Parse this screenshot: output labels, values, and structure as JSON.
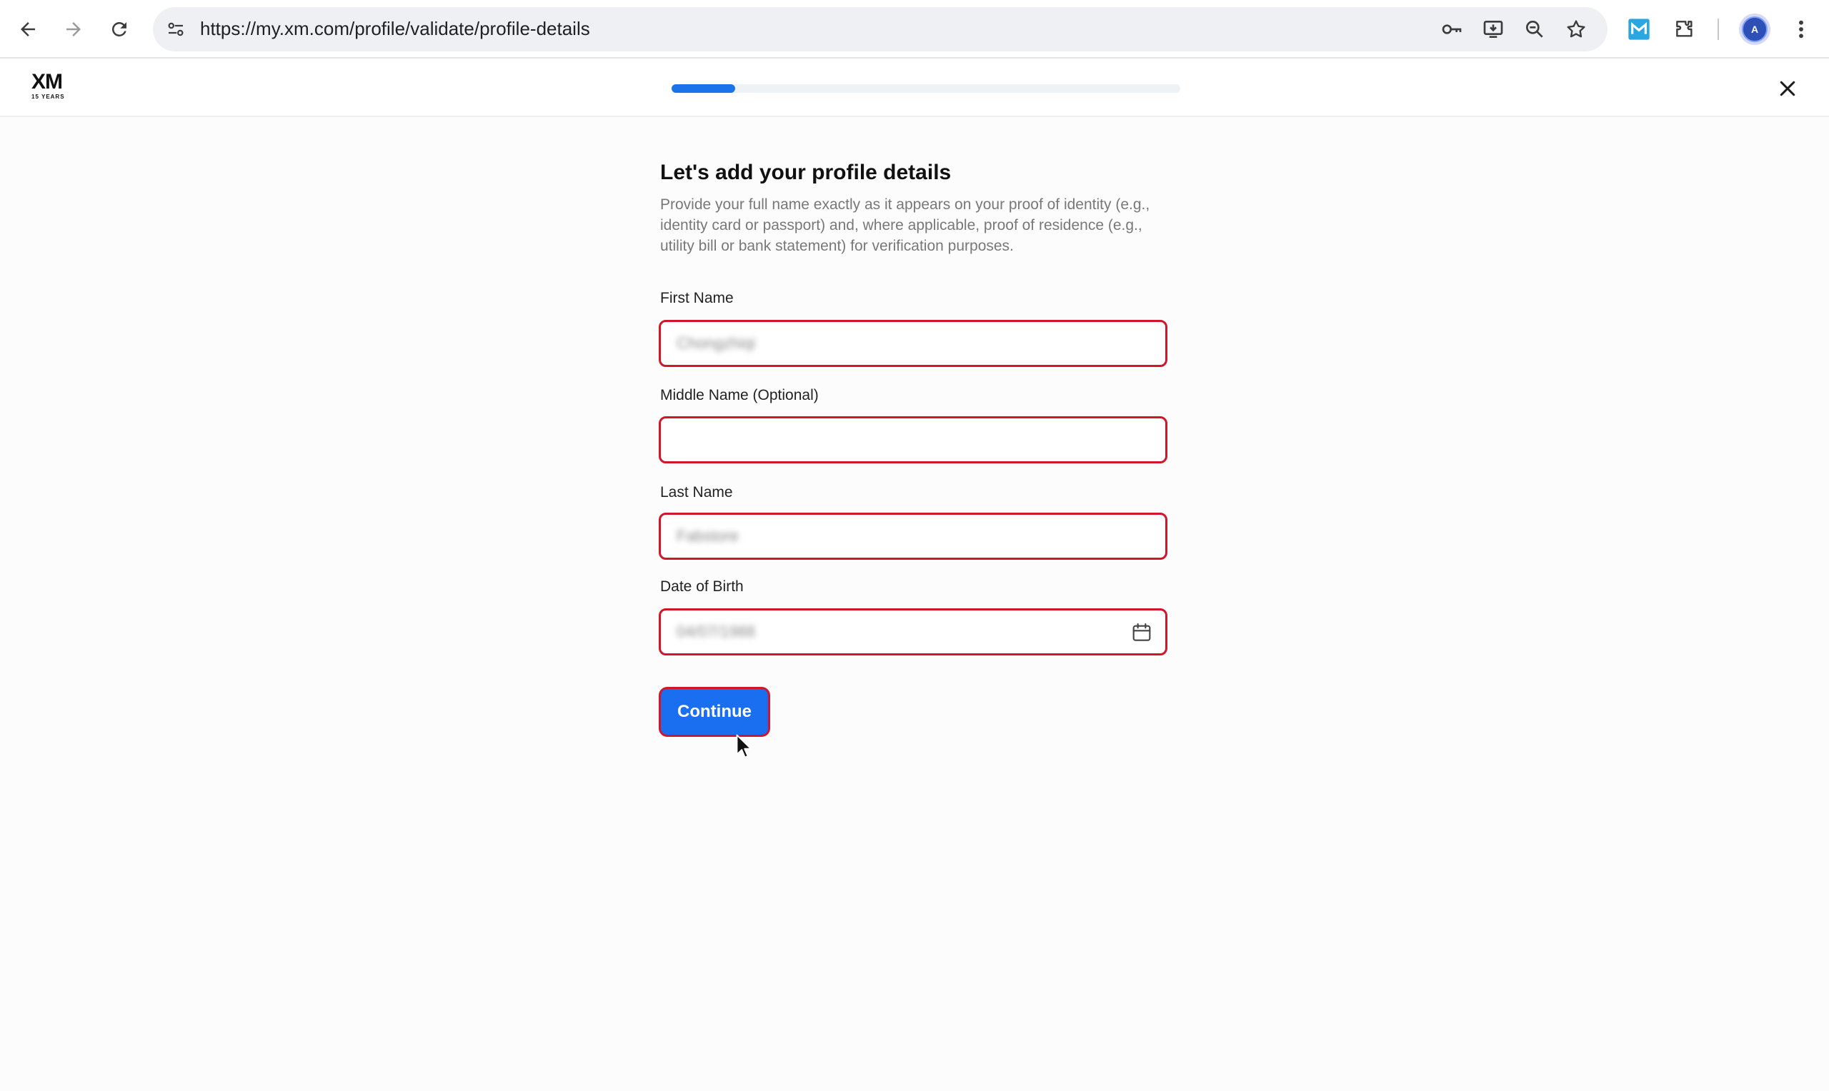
{
  "browser": {
    "url": "https://my.xm.com/profile/validate/profile-details",
    "back_icon": "arrow-left-icon",
    "forward_icon": "arrow-right-icon",
    "reload_icon": "reload-icon",
    "avatar_letter": "A"
  },
  "header": {
    "logo_text": "XM",
    "logo_subtext": "15 YEARS",
    "progress_fraction": 0.125
  },
  "form": {
    "title": "Let's add your profile details",
    "description": "Provide your full name exactly as it appears on your proof of identity (e.g., identity card or passport) and, where applicable, proof of residence (e.g., utility bill or bank statement) for verification purposes.",
    "first_name": {
      "label": "First Name",
      "value": "Chongzhiqi"
    },
    "middle_name": {
      "label": "Middle Name (Optional)",
      "value": ""
    },
    "last_name": {
      "label": "Last Name",
      "value": "Fabstore"
    },
    "dob": {
      "label": "Date of Birth",
      "value": "04/07/1988"
    },
    "continue_label": "Continue"
  },
  "colors": {
    "accent": "#1a6ef0",
    "error_border": "#d3152a",
    "progress": "#1a73e8"
  }
}
